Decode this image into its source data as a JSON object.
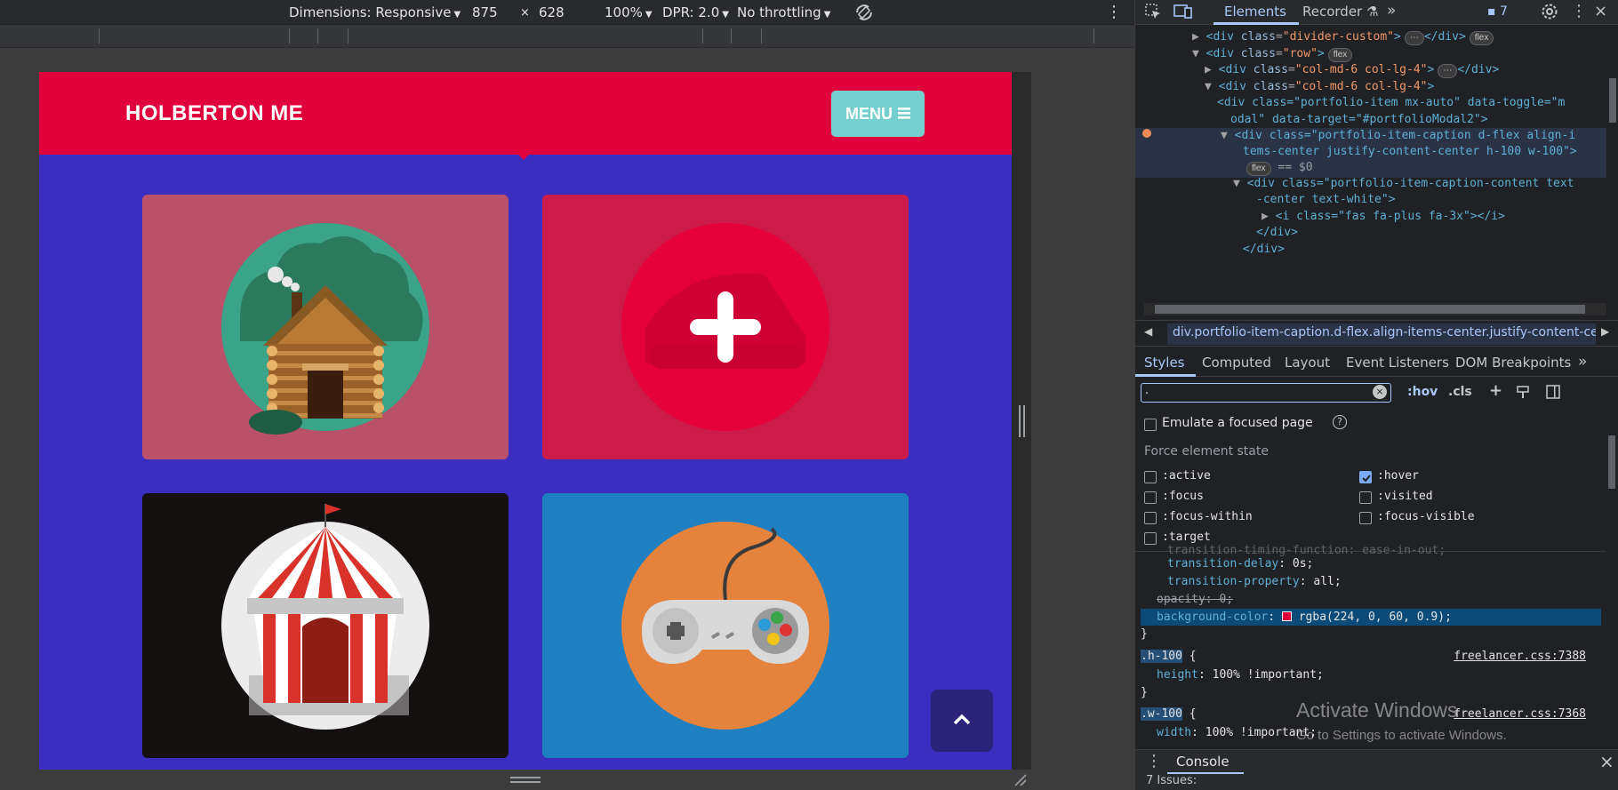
{
  "devtools_toolbar": {
    "dimensions": "Dimensions: Responsive",
    "width": "875",
    "times": "×",
    "height": "628",
    "zoom": "100%",
    "dpr": "DPR: 2.0",
    "throttle": "No throttling"
  },
  "site": {
    "brand": "HOLBERTON ME",
    "menu_label": "MENU"
  },
  "devtools": {
    "tabs": [
      "Elements",
      "Recorder"
    ],
    "issues_count": "7",
    "elements": [
      {
        "indent": 0,
        "text_tag": "<div class=",
        "cls": "\"divider-custom\"",
        "tail": "></div>",
        "badge": "flex",
        "arrow": "▶"
      },
      {
        "indent": 0,
        "text_tag": "<div class=",
        "cls": "\"row\"",
        "tail": ">",
        "badge": "flex",
        "arrow": "▼"
      },
      {
        "indent": 1,
        "text_tag": "<div class=",
        "cls": "\"col-md-6 col-lg-4\"",
        "tail": "></div>",
        "badge": "",
        "arrow": "▶"
      },
      {
        "indent": 1,
        "text_tag": "<div class=",
        "cls": "\"col-md-6 col-lg-4\"",
        "tail": ">",
        "badge": "",
        "arrow": "▼"
      }
    ],
    "elements_raw": {
      "l5a": "<div class=\"portfolio-item mx-auto\" data-toggle=\"m",
      "l5b": "odal\" data-target=\"#portfolioModal2\">",
      "l6a": "<div class=\"portfolio-item-caption d-flex align-i",
      "l6b": "tems-center justify-content-center h-100 w-100\">",
      "l6c": "== $0",
      "l7a": "<div class=\"portfolio-item-caption-content text",
      "l7b": "-center text-white\">",
      "l8": "<i class=\"fas fa-plus fa-3x\"></i>",
      "l9": "</div>",
      "l10": "</div>"
    },
    "breadcrumb": "div.portfolio-item-caption.d-flex.align-items-center.justify-content-center",
    "sub_tabs": [
      "Styles",
      "Computed",
      "Layout",
      "Event Listeners",
      "DOM Breakpoints"
    ],
    "filter_value": ".",
    "hov": ":hov",
    "cls": ".cls",
    "emulate_focus": "Emulate a focused page",
    "force_state": "Force element state",
    "states": {
      "active": ":active",
      "hover": ":hover",
      "focus": ":focus",
      "visited": ":visited",
      "focus_within": ":focus-within",
      "focus_visible": ":focus-visible",
      "target": ":target"
    },
    "css": {
      "l0": "transition-timing-function: ease-in-out;",
      "l1_prop": "transition-delay",
      "l1_val": "0s;",
      "l2_prop": "transition-property",
      "l2_val": "all;",
      "l3": "opacity: 0;",
      "l4_prop": "background-color",
      "l4_val": "rgba(224, 0, 60, 0.9);",
      "close": "}",
      "h100_sel": ".h-100",
      "h100_open": " {",
      "h100_src": "freelancer.css:7388",
      "h100_prop": "height",
      "h100_val": "100% !important;",
      "w100_sel": ".w-100",
      "w100_open": " {",
      "w100_src": "freelancer.css:7368",
      "w100_prop": "width",
      "w100_val": "100% !important;"
    },
    "console_label": "Console",
    "issues_text": "7 Issues:"
  },
  "watermark": {
    "line1": "Activate Windows",
    "line2": "Go to Settings to activate Windows."
  },
  "colors": {
    "navbar": "#e0003c",
    "page_bg": "#3b2dbf",
    "menu_btn": "#76cfcf",
    "card1": "#b85169",
    "card2": "#cc1a4a",
    "card3": "#141010",
    "card4": "#1e80c1",
    "swatch": "#e0003c"
  }
}
